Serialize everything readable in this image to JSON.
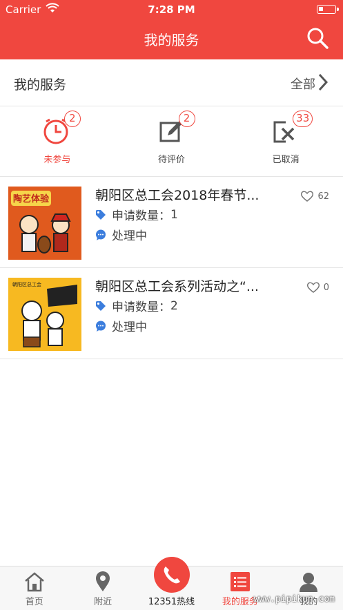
{
  "status_bar": {
    "carrier": "Carrier",
    "time": "7:28 PM"
  },
  "header": {
    "title": "我的服务"
  },
  "section": {
    "title": "我的服务",
    "all_label": "全部"
  },
  "tabs": [
    {
      "label": "未参与",
      "badge": "2",
      "icon": "clock-icon",
      "active": true
    },
    {
      "label": "待评价",
      "badge": "2",
      "icon": "edit-icon",
      "active": false
    },
    {
      "label": "已取消",
      "badge": "33",
      "icon": "cancel-doc-icon",
      "active": false
    }
  ],
  "items": [
    {
      "title": "朝阳区总工会2018年春节...",
      "likes": "62",
      "quantity_label": "申请数量：",
      "quantity": "1",
      "status": "处理中",
      "thumb_text": "陶艺体验"
    },
    {
      "title": "朝阳区总工会系列活动之“...",
      "likes": "0",
      "quantity_label": "申请数量：",
      "quantity": "2",
      "status": "处理中",
      "thumb_text": "朝阳区总工会"
    }
  ],
  "tabbar": [
    {
      "label": "首页",
      "icon": "home-icon"
    },
    {
      "label": "附近",
      "icon": "location-icon"
    },
    {
      "label": "12351热线",
      "icon": "phone-icon"
    },
    {
      "label": "我的服务",
      "icon": "list-icon"
    },
    {
      "label": "我的",
      "icon": "user-icon"
    }
  ],
  "watermark": "www.pipikun.com",
  "colors": {
    "accent": "#f0473f"
  }
}
